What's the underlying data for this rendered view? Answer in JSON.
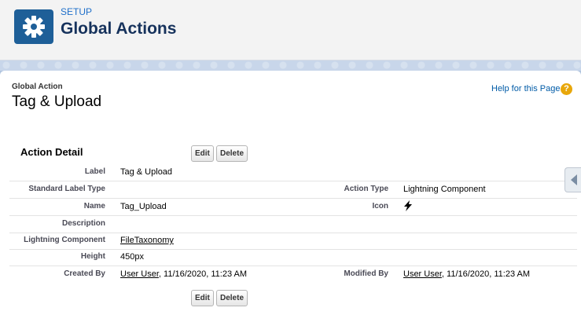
{
  "header": {
    "breadcrumb": "SETUP",
    "title": "Global Actions",
    "icon": "gear-icon"
  },
  "page": {
    "object_label": "Global Action",
    "record_title": "Tag & Upload",
    "help_link": "Help for this Page",
    "help_icon": "?"
  },
  "detail": {
    "section_title": "Action Detail",
    "edit_label": "Edit",
    "delete_label": "Delete",
    "fields": {
      "label": {
        "label": "Label",
        "value": "Tag & Upload"
      },
      "standard_label_type": {
        "label": "Standard Label Type",
        "value": ""
      },
      "action_type": {
        "label": "Action Type",
        "value": "Lightning Component"
      },
      "name": {
        "label": "Name",
        "value": "Tag_Upload"
      },
      "icon": {
        "label": "Icon",
        "value": "lightning-bolt-icon"
      },
      "description": {
        "label": "Description",
        "value": ""
      },
      "lightning_component": {
        "label": "Lightning Component",
        "value": "FileTaxonomy"
      },
      "height": {
        "label": "Height",
        "value": "450px"
      },
      "created_by": {
        "label": "Created By",
        "user": "User User",
        "date": ", 11/16/2020, 11:23 AM"
      },
      "modified_by": {
        "label": "Modified By",
        "user": "User User",
        "date": ", 11/16/2020, 11:23 AM"
      }
    }
  },
  "colors": {
    "header_icon_bg": "#1e5f98",
    "help_icon_bg": "#e8a70b",
    "page_bg": "#b0c4df",
    "link_blue": "#015ba7"
  }
}
